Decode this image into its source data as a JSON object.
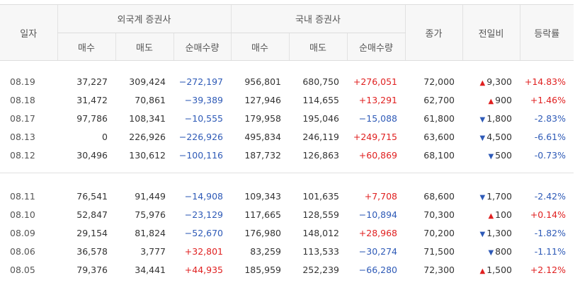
{
  "header": {
    "date": "일자",
    "foreign": "외국계 증권사",
    "domestic": "국내 증권사",
    "close": "종가",
    "change": "전일비",
    "rate": "등락률",
    "buy": "매수",
    "sell": "매도",
    "net": "순매수량"
  },
  "groups": [
    [
      {
        "date": "08.19",
        "f_buy": "37,227",
        "f_sell": "309,424",
        "f_net": "−272,197",
        "d_buy": "956,801",
        "d_sell": "680,750",
        "d_net": "+276,051",
        "close": "72,000",
        "chg": "9,300",
        "dir": "up",
        "rate": "+14.83%"
      },
      {
        "date": "08.18",
        "f_buy": "31,472",
        "f_sell": "70,861",
        "f_net": "−39,389",
        "d_buy": "127,946",
        "d_sell": "114,655",
        "d_net": "+13,291",
        "close": "62,700",
        "chg": "900",
        "dir": "up",
        "rate": "+1.46%"
      },
      {
        "date": "08.17",
        "f_buy": "97,786",
        "f_sell": "108,341",
        "f_net": "−10,555",
        "d_buy": "179,958",
        "d_sell": "195,046",
        "d_net": "−15,088",
        "close": "61,800",
        "chg": "1,800",
        "dir": "down",
        "rate": "-2.83%"
      },
      {
        "date": "08.13",
        "f_buy": "0",
        "f_sell": "226,926",
        "f_net": "−226,926",
        "d_buy": "495,834",
        "d_sell": "246,119",
        "d_net": "+249,715",
        "close": "63,600",
        "chg": "4,500",
        "dir": "down",
        "rate": "-6.61%"
      },
      {
        "date": "08.12",
        "f_buy": "30,496",
        "f_sell": "130,612",
        "f_net": "−100,116",
        "d_buy": "187,732",
        "d_sell": "126,863",
        "d_net": "+60,869",
        "close": "68,100",
        "chg": "500",
        "dir": "down",
        "rate": "-0.73%"
      }
    ],
    [
      {
        "date": "08.11",
        "f_buy": "76,541",
        "f_sell": "91,449",
        "f_net": "−14,908",
        "d_buy": "109,343",
        "d_sell": "101,635",
        "d_net": "+7,708",
        "close": "68,600",
        "chg": "1,700",
        "dir": "down",
        "rate": "-2.42%"
      },
      {
        "date": "08.10",
        "f_buy": "52,847",
        "f_sell": "75,976",
        "f_net": "−23,129",
        "d_buy": "117,665",
        "d_sell": "128,559",
        "d_net": "−10,894",
        "close": "70,300",
        "chg": "100",
        "dir": "up",
        "rate": "+0.14%"
      },
      {
        "date": "08.09",
        "f_buy": "29,154",
        "f_sell": "81,824",
        "f_net": "−52,670",
        "d_buy": "176,980",
        "d_sell": "148,012",
        "d_net": "+28,968",
        "close": "70,200",
        "chg": "1,300",
        "dir": "down",
        "rate": "-1.82%"
      },
      {
        "date": "08.06",
        "f_buy": "36,578",
        "f_sell": "3,777",
        "f_net": "+32,801",
        "d_buy": "83,259",
        "d_sell": "113,533",
        "d_net": "−30,274",
        "close": "71,500",
        "chg": "800",
        "dir": "down",
        "rate": "-1.11%"
      },
      {
        "date": "08.05",
        "f_buy": "79,376",
        "f_sell": "34,441",
        "f_net": "+44,935",
        "d_buy": "185,959",
        "d_sell": "252,239",
        "d_net": "−66,280",
        "close": "72,300",
        "chg": "1,500",
        "dir": "up",
        "rate": "+2.12%"
      }
    ]
  ],
  "colors": {
    "up": "#e02020",
    "down": "#2e5ab7"
  },
  "icons": {
    "up": "triangle-up-icon",
    "down": "triangle-down-icon"
  }
}
